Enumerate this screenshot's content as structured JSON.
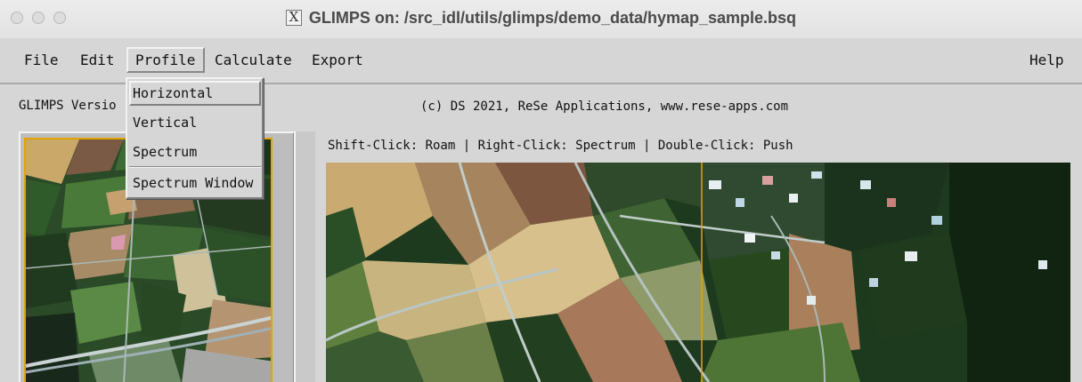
{
  "window": {
    "title": "GLIMPS on: /src_idl/utils/glimps/demo_data/hymap_sample.bsq",
    "x_glyph": "X"
  },
  "menubar": {
    "items": [
      "File",
      "Edit",
      "Profile",
      "Calculate",
      "Export"
    ],
    "help": "Help",
    "active_item": "Profile"
  },
  "profile_menu": {
    "items": [
      "Horizontal",
      "Vertical",
      "Spectrum",
      "Spectrum Window"
    ],
    "highlighted": "Horizontal"
  },
  "info": {
    "version_label": "GLIMPS Versio",
    "copyright": "(c) DS 2021, ReSe Applications, www.rese-apps.com",
    "instructions": "Shift-Click: Roam | Right-Click: Spectrum | Double-Click: Push"
  },
  "colors": {
    "window_bg": "#d6d6d6",
    "crosshair": "#e2a400",
    "field_tan": "#c9a86a",
    "field_green": "#2f5a2a",
    "field_brown": "#7a5a44",
    "forest": "#1a2c1a",
    "road": "#b9c6c6"
  }
}
